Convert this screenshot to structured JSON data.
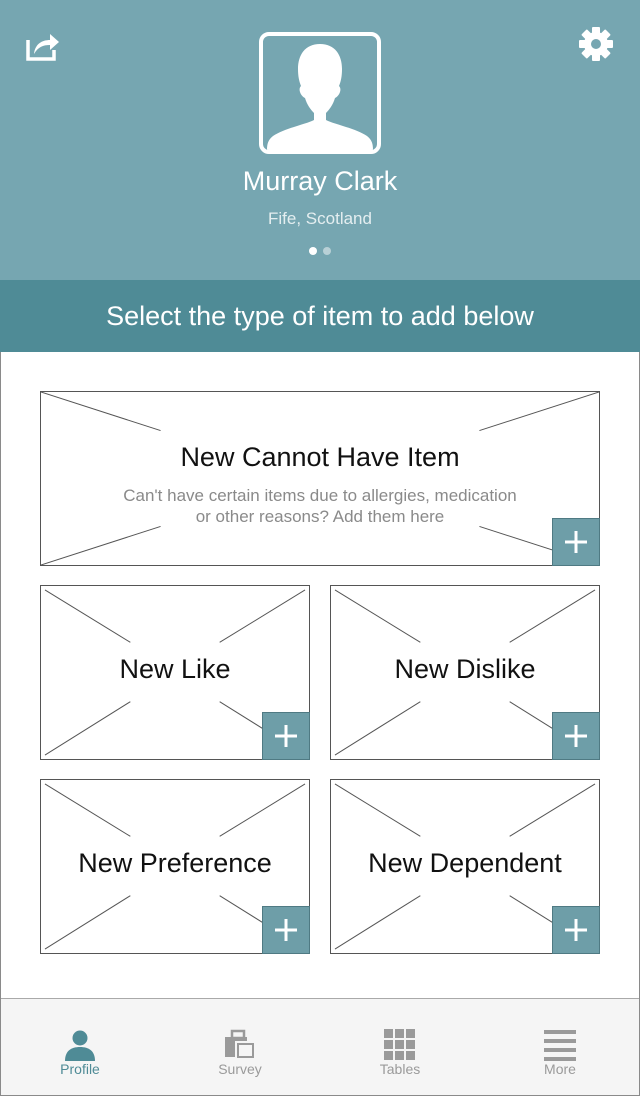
{
  "profile": {
    "name": "Murray Clark",
    "location": "Fife, Scotland",
    "pager": {
      "pages": 2,
      "current": 1
    }
  },
  "header_icons": {
    "share": "share-icon",
    "settings": "gear-icon"
  },
  "banner": {
    "text": "Select the type of item to add below"
  },
  "cards": {
    "cannot_have": {
      "title": "New Cannot Have Item",
      "description_line1": "Can't have certain items due to allergies, medication",
      "description_line2": "or other reasons? Add them here"
    },
    "like": {
      "title": "New Like"
    },
    "dislike": {
      "title": "New Dislike"
    },
    "preference": {
      "title": "New Preference"
    },
    "dependent": {
      "title": "New Dependent"
    },
    "add_icon": "plus-icon"
  },
  "tabs": [
    {
      "label": "Profile",
      "icon": "person-icon",
      "active": true
    },
    {
      "label": "Survey",
      "icon": "briefcase-icon",
      "active": false
    },
    {
      "label": "Tables",
      "icon": "grid-icon",
      "active": false
    },
    {
      "label": "More",
      "icon": "menu-icon",
      "active": false
    }
  ],
  "colors": {
    "header_bg": "#76a6b1",
    "banner_bg": "#4f8b96",
    "add_button_bg": "#6e9ea8",
    "tab_active": "#4f8b96",
    "tab_inactive": "#9a9a9a"
  }
}
